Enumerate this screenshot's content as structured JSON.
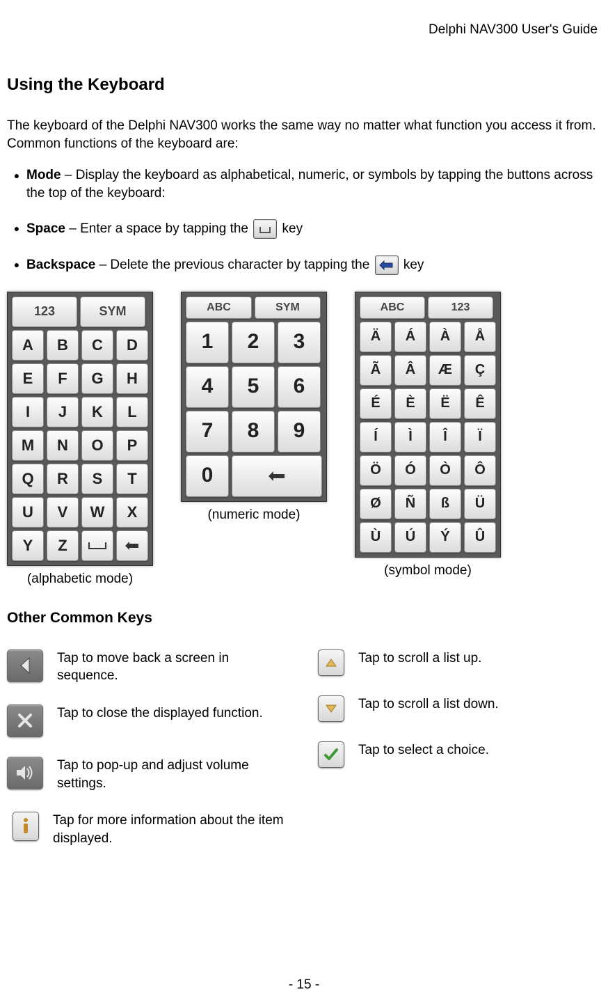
{
  "header": "Delphi NAV300 User's Guide",
  "title": "Using the Keyboard",
  "intro": "The keyboard of the Delphi NAV300 works the same way no matter what function you access it from.  Common functions of the keyboard are:",
  "bullets": {
    "mode_label": "Mode",
    "mode_text": " – Display the keyboard as alphabetical, numeric, or symbols by tapping the buttons across the top of the keyboard:",
    "space_label": "Space",
    "space_pre": " – Enter a space by tapping the ",
    "space_post": " key",
    "back_label": "Backspace",
    "back_pre": " – Delete the previous character by tapping the ",
    "back_post": " key"
  },
  "kb_alpha": {
    "tabs": [
      "123",
      "SYM"
    ],
    "rows": [
      [
        "A",
        "B",
        "C",
        "D"
      ],
      [
        "E",
        "F",
        "G",
        "H"
      ],
      [
        "I",
        "J",
        "K",
        "L"
      ],
      [
        "M",
        "N",
        "O",
        "P"
      ],
      [
        "Q",
        "R",
        "S",
        "T"
      ],
      [
        "U",
        "V",
        "W",
        "X"
      ],
      [
        "Y",
        "Z",
        "␣",
        "⌫"
      ]
    ],
    "caption": "(alphabetic mode)"
  },
  "kb_num": {
    "tabs": [
      "ABC",
      "SYM"
    ],
    "rows": [
      [
        "1",
        "2",
        "3"
      ],
      [
        "4",
        "5",
        "6"
      ],
      [
        "7",
        "8",
        "9"
      ],
      [
        "0",
        "⌫"
      ]
    ],
    "caption": "(numeric mode)"
  },
  "kb_sym": {
    "tabs": [
      "ABC",
      "123"
    ],
    "rows": [
      [
        "Ä",
        "Á",
        "À",
        "Å"
      ],
      [
        "Ã",
        "Â",
        "Æ",
        "Ç"
      ],
      [
        "É",
        "È",
        "Ë",
        "Ê"
      ],
      [
        "Í",
        "Ì",
        "Î",
        "Ï"
      ],
      [
        "Ö",
        "Ó",
        "Ò",
        "Ô"
      ],
      [
        "Ø",
        "Ñ",
        "ß",
        "Ü"
      ],
      [
        "Ù",
        "Ú",
        "Ý",
        "Û"
      ]
    ],
    "caption": "(symbol mode)"
  },
  "other_title": "Other Common Keys",
  "ck_left": [
    {
      "icon": "back",
      "text": "Tap to move back a screen in sequence."
    },
    {
      "icon": "close",
      "text": "Tap to close the displayed function."
    },
    {
      "icon": "volume",
      "text": "Tap to pop-up and adjust volume settings."
    },
    {
      "icon": "info",
      "text": "Tap for more information about the item displayed."
    }
  ],
  "ck_right": [
    {
      "icon": "up",
      "text": "Tap to scroll a list up."
    },
    {
      "icon": "down",
      "text": "Tap to scroll a list down."
    },
    {
      "icon": "check",
      "text": "Tap to select a choice."
    }
  ],
  "page_num": "- 15 -"
}
